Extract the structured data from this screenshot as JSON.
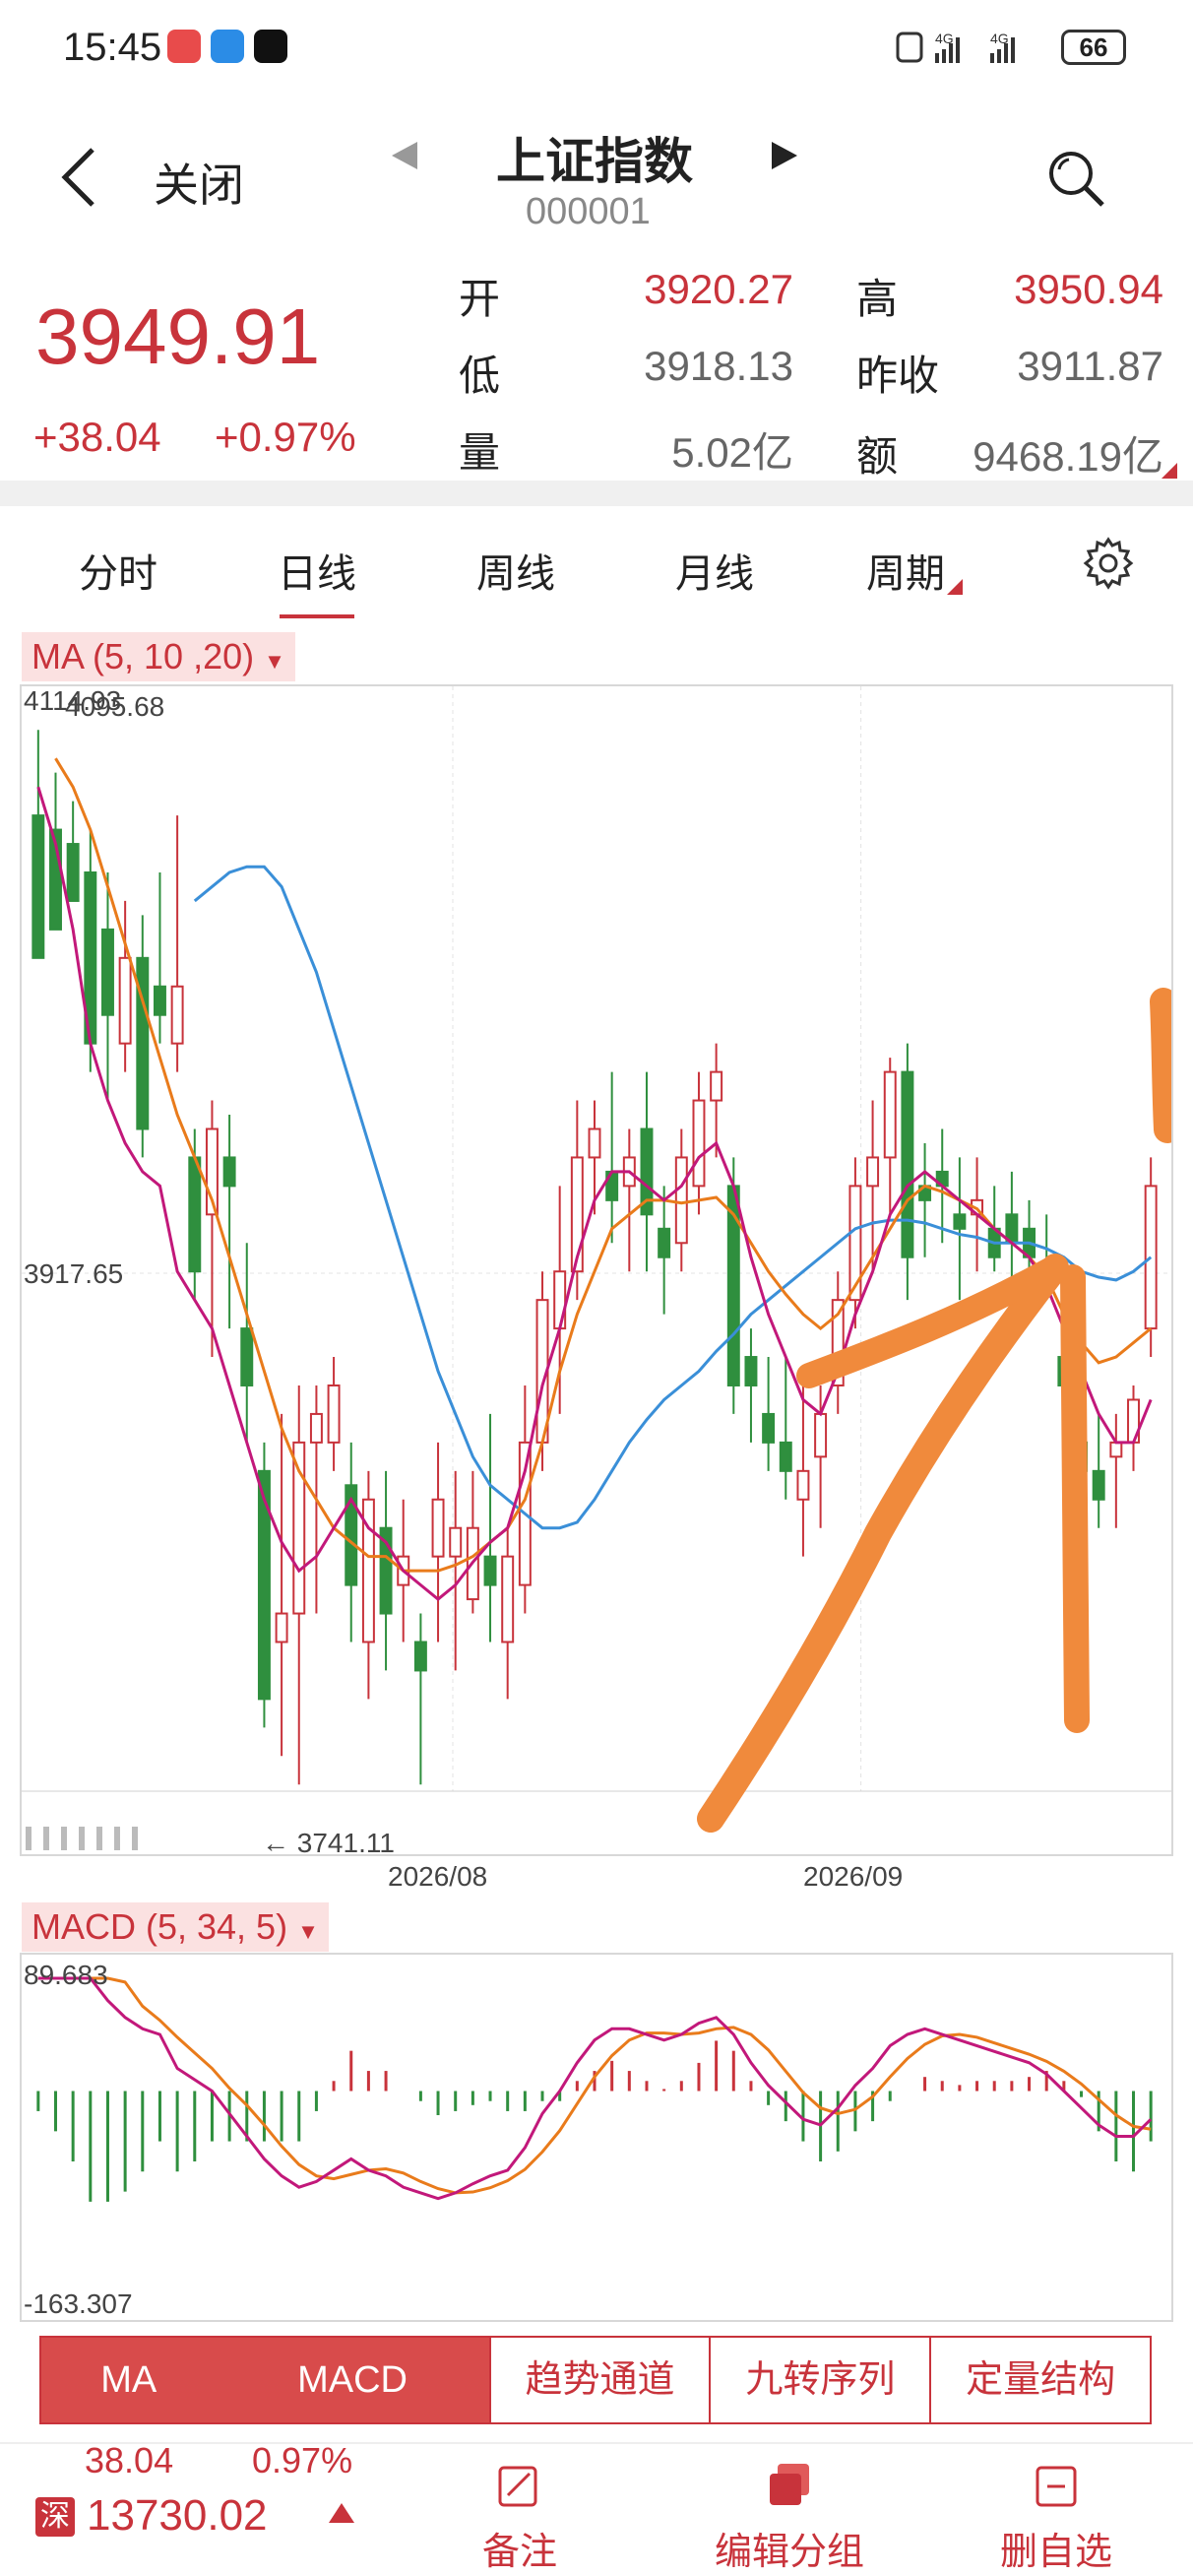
{
  "status_bar": {
    "time": "15:45",
    "battery": "66",
    "icons": [
      "red-app-icon",
      "chat-app-icon",
      "tiktok-icon",
      "nfc-icon",
      "signal-4g-icon",
      "signal-4g-icon"
    ]
  },
  "header": {
    "close_label": "关闭",
    "title": "上证指数",
    "code": "000001",
    "back_icon": "chevron-left-icon",
    "prev_icon": "triangle-left-icon",
    "next_icon": "triangle-right-icon",
    "search_icon": "search-icon"
  },
  "quote": {
    "price": "3949.91",
    "change": "+38.04",
    "change_pct": "+0.97%",
    "open_label": "开",
    "open": "3920.27",
    "high_label": "高",
    "high": "3950.94",
    "low_label": "低",
    "low": "3918.13",
    "prev_close_label": "昨收",
    "prev_close": "3911.87",
    "volume_label": "量",
    "volume": "5.02亿",
    "amount_label": "额",
    "amount": "9468.19亿"
  },
  "tabs": [
    {
      "label": "分时",
      "active": false
    },
    {
      "label": "日线",
      "active": true
    },
    {
      "label": "周线",
      "active": false
    },
    {
      "label": "月线",
      "active": false
    },
    {
      "label": "周期",
      "active": false
    }
  ],
  "settings_icon": "gear-icon",
  "ma_chart": {
    "indicator_label": "MA (5, 10 ,20)",
    "top_labels": [
      "4114.93",
      "4095.68"
    ],
    "mid_label": "3917.65",
    "low_label": "← 3741.11",
    "date_labels": [
      "2026/08",
      "2026/09"
    ]
  },
  "macd_chart": {
    "indicator_label": "MACD (5, 34, 5)",
    "max_label": "89.683",
    "min_label": "-163.307"
  },
  "indicator_buttons": [
    "MA",
    "MACD",
    "趋势通道",
    "九转序列",
    "定量结构"
  ],
  "bottom": {
    "sub_change": "38.04",
    "sub_pct": "0.97%",
    "market_tag": "深",
    "market_value": "13730.02",
    "actions": [
      "备注",
      "编辑分组",
      "删自选"
    ],
    "action_icons": [
      "note-icon",
      "edit-group-icon",
      "remove-watchlist-icon"
    ]
  },
  "chart_data": {
    "type": "candlestick",
    "title": "",
    "x_date_labels": [
      "2026/08",
      "2026/09"
    ],
    "ylim": [
      3741.11,
      4114.93
    ],
    "series": [
      {
        "name": "MA5",
        "color": "#c2187a"
      },
      {
        "name": "MA10",
        "color": "#e97b1b"
      },
      {
        "name": "MA20",
        "color": "#3a8fd8"
      }
    ],
    "candles_ohlc": [
      [
        4080,
        4110,
        4050,
        4030
      ],
      [
        4075,
        4095,
        4060,
        4040
      ],
      [
        4070,
        4085,
        4055,
        4050
      ],
      [
        4060,
        4075,
        3990,
        4000
      ],
      [
        4040,
        4060,
        3980,
        4010
      ],
      [
        4000,
        4050,
        3990,
        4030
      ],
      [
        4030,
        4045,
        3960,
        3970
      ],
      [
        4020,
        4060,
        4000,
        4010
      ],
      [
        4000,
        4080,
        3990,
        4020
      ],
      [
        3960,
        3970,
        3910,
        3920
      ],
      [
        3940,
        3980,
        3890,
        3970
      ],
      [
        3960,
        3975,
        3900,
        3950
      ],
      [
        3900,
        3930,
        3860,
        3880
      ],
      [
        3850,
        3860,
        3760,
        3770
      ],
      [
        3790,
        3870,
        3750,
        3800
      ],
      [
        3800,
        3880,
        3740,
        3860
      ],
      [
        3860,
        3880,
        3800,
        3870
      ],
      [
        3860,
        3890,
        3850,
        3880
      ],
      [
        3845,
        3860,
        3790,
        3810
      ],
      [
        3790,
        3850,
        3770,
        3840
      ],
      [
        3830,
        3850,
        3780,
        3800
      ],
      [
        3810,
        3840,
        3790,
        3820
      ],
      [
        3790,
        3800,
        3740,
        3780
      ],
      [
        3820,
        3860,
        3790,
        3840
      ],
      [
        3820,
        3850,
        3780,
        3830
      ],
      [
        3805,
        3850,
        3800,
        3830
      ],
      [
        3820,
        3870,
        3790,
        3810
      ],
      [
        3790,
        3830,
        3770,
        3820
      ],
      [
        3810,
        3880,
        3800,
        3860
      ],
      [
        3860,
        3920,
        3850,
        3910
      ],
      [
        3900,
        3950,
        3870,
        3920
      ],
      [
        3920,
        3980,
        3910,
        3960
      ],
      [
        3960,
        3980,
        3940,
        3970
      ],
      [
        3955,
        3990,
        3930,
        3945
      ],
      [
        3950,
        3970,
        3920,
        3960
      ],
      [
        3970,
        3990,
        3920,
        3940
      ],
      [
        3935,
        3950,
        3905,
        3925
      ],
      [
        3930,
        3970,
        3920,
        3960
      ],
      [
        3950,
        3990,
        3940,
        3980
      ],
      [
        3980,
        4000,
        3960,
        3990
      ],
      [
        3950,
        3960,
        3870,
        3880
      ],
      [
        3890,
        3900,
        3860,
        3880
      ],
      [
        3870,
        3890,
        3850,
        3860
      ],
      [
        3860,
        3890,
        3840,
        3850
      ],
      [
        3840,
        3880,
        3820,
        3850
      ],
      [
        3855,
        3880,
        3830,
        3870
      ],
      [
        3880,
        3920,
        3870,
        3910
      ],
      [
        3910,
        3960,
        3900,
        3950
      ],
      [
        3950,
        3980,
        3920,
        3960
      ],
      [
        3960,
        3995,
        3940,
        3990
      ],
      [
        3990,
        4000,
        3910,
        3925
      ],
      [
        3950,
        3965,
        3925,
        3945
      ],
      [
        3955,
        3970,
        3930,
        3950
      ],
      [
        3940,
        3960,
        3910,
        3935
      ],
      [
        3940,
        3960,
        3920,
        3945
      ],
      [
        3935,
        3950,
        3920,
        3925
      ],
      [
        3940,
        3955,
        3910,
        3930
      ],
      [
        3935,
        3945,
        3920,
        3925
      ],
      [
        3920,
        3940,
        3910,
        3915
      ],
      [
        3890,
        3920,
        3860,
        3880
      ],
      [
        3860,
        3880,
        3830,
        3850
      ],
      [
        3850,
        3870,
        3830,
        3840
      ],
      [
        3855,
        3870,
        3830,
        3860
      ],
      [
        3860,
        3880,
        3850,
        3875
      ],
      [
        3900,
        3960,
        3890,
        3950
      ]
    ],
    "ma5": [
      4090,
      4070,
      4040,
      4000,
      3980,
      3965,
      3955,
      3950,
      3920,
      3910,
      3900,
      3880,
      3860,
      3840,
      3825,
      3815,
      3820,
      3830,
      3840,
      3830,
      3825,
      3815,
      3810,
      3805,
      3810,
      3818,
      3825,
      3830,
      3850,
      3880,
      3900,
      3925,
      3945,
      3955,
      3955,
      3950,
      3945,
      3950,
      3960,
      3965,
      3950,
      3925,
      3905,
      3890,
      3875,
      3870,
      3885,
      3905,
      3920,
      3940,
      3950,
      3955,
      3950,
      3945,
      3940,
      3935,
      3930,
      3925,
      3915,
      3900,
      3885,
      3870,
      3860,
      3860,
      3875
    ],
    "ma10": [
      4100,
      4090,
      4075,
      4055,
      4035,
      4015,
      3995,
      3975,
      3960,
      3945,
      3925,
      3905,
      3885,
      3865,
      3850,
      3840,
      3830,
      3825,
      3820,
      3820,
      3815,
      3815,
      3815,
      3817,
      3820,
      3825,
      3830,
      3840,
      3860,
      3885,
      3905,
      3920,
      3935,
      3940,
      3945,
      3945,
      3944,
      3945,
      3946,
      3940,
      3930,
      3920,
      3912,
      3905,
      3900,
      3905,
      3915,
      3925,
      3935,
      3945,
      3950,
      3948,
      3945,
      3942,
      3935,
      3930,
      3925,
      3918,
      3905,
      3895,
      3888,
      3890,
      3895,
      3900
    ],
    "ma20": [
      4050,
      4055,
      4060,
      4062,
      4062,
      4055,
      4040,
      4025,
      4005,
      3985,
      3965,
      3945,
      3925,
      3905,
      3885,
      3870,
      3855,
      3845,
      3840,
      3835,
      3830,
      3830,
      3832,
      3840,
      3850,
      3860,
      3868,
      3875,
      3880,
      3885,
      3892,
      3898,
      3905,
      3910,
      3915,
      3920,
      3925,
      3930,
      3935,
      3937,
      3938,
      3938,
      3937,
      3935,
      3933,
      3932,
      3930,
      3930,
      3930,
      3928,
      3925,
      3920,
      3918,
      3917,
      3920,
      3925
    ],
    "macd_ylim": [
      -163.307,
      89.683
    ]
  }
}
